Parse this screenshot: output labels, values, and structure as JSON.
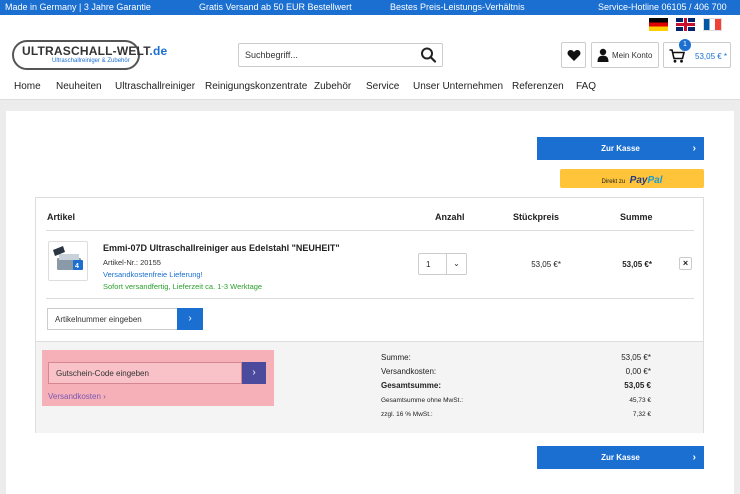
{
  "topbar": {
    "made_in": "Made in Germany | 3 Jahre Garantie",
    "shipping": "Gratis Versand ab 50 EUR Bestellwert",
    "value": "Bestes Preis-Leistungs-Verhältnis",
    "hotline": "Service-Hotline 06105 / 406 700"
  },
  "logo": {
    "main": "ULTRASCHALL-WELT",
    "tld": ".de",
    "sub": "Ultraschallreiniger & Zubehör"
  },
  "search": {
    "placeholder": "Suchbegriff..."
  },
  "header": {
    "account_label": "Mein Konto",
    "cart_count": "1",
    "cart_amount": "53,05 € *"
  },
  "nav": {
    "home": "Home",
    "neuheiten": "Neuheiten",
    "ultraschallreiniger": "Ultraschallreiniger",
    "reinigungskonzentrate": "Reinigungskonzentrate",
    "zubehoer": "Zubehör",
    "service": "Service",
    "unternehmen": "Unser Unternehmen",
    "referenzen": "Referenzen",
    "faq": "FAQ"
  },
  "checkout": {
    "label": "Zur Kasse",
    "paypal_prefix": "Direkt zu",
    "paypal_brand_1": "Pay",
    "paypal_brand_2": "Pal"
  },
  "table": {
    "col_article": "Artikel",
    "col_qty": "Anzahl",
    "col_unit": "Stückpreis",
    "col_total": "Summe"
  },
  "item": {
    "title": "Emmi-07D Ultraschallreiniger aus Edelstahl \"NEUHEIT\"",
    "article_no": "Artikel-Nr.: 20155",
    "shipping_note": "Versandkostenfreie Lieferung!",
    "availability": "Sofort versandfertig, Lieferzeit ca. 1-3 Werktage",
    "quantity": "1",
    "unit_price": "53,05 €*",
    "total_price": "53,05 €*",
    "remove": "×"
  },
  "article_input": {
    "placeholder": "Artikelnummer eingeben"
  },
  "voucher": {
    "placeholder": "Gutschein-Code eingeben",
    "shipping_link": "Versandkosten ›"
  },
  "summary": {
    "sum_label": "Summe:",
    "sum_value": "53,05 €*",
    "shipping_label": "Versandkosten:",
    "shipping_value": "0,00 €*",
    "total_label": "Gesamtsumme:",
    "total_value": "53,05 €",
    "net_label": "Gesamtsumme ohne MwSt.:",
    "net_value": "45,73 €",
    "vat_label": "zzgl. 16 % MwSt.:",
    "vat_value": "7,32 €"
  },
  "colors": {
    "primary": "#1a6fd1",
    "highlight": "#f6b0b8",
    "voucher_button": "#4b4a9d",
    "paypal": "#ffc439"
  }
}
